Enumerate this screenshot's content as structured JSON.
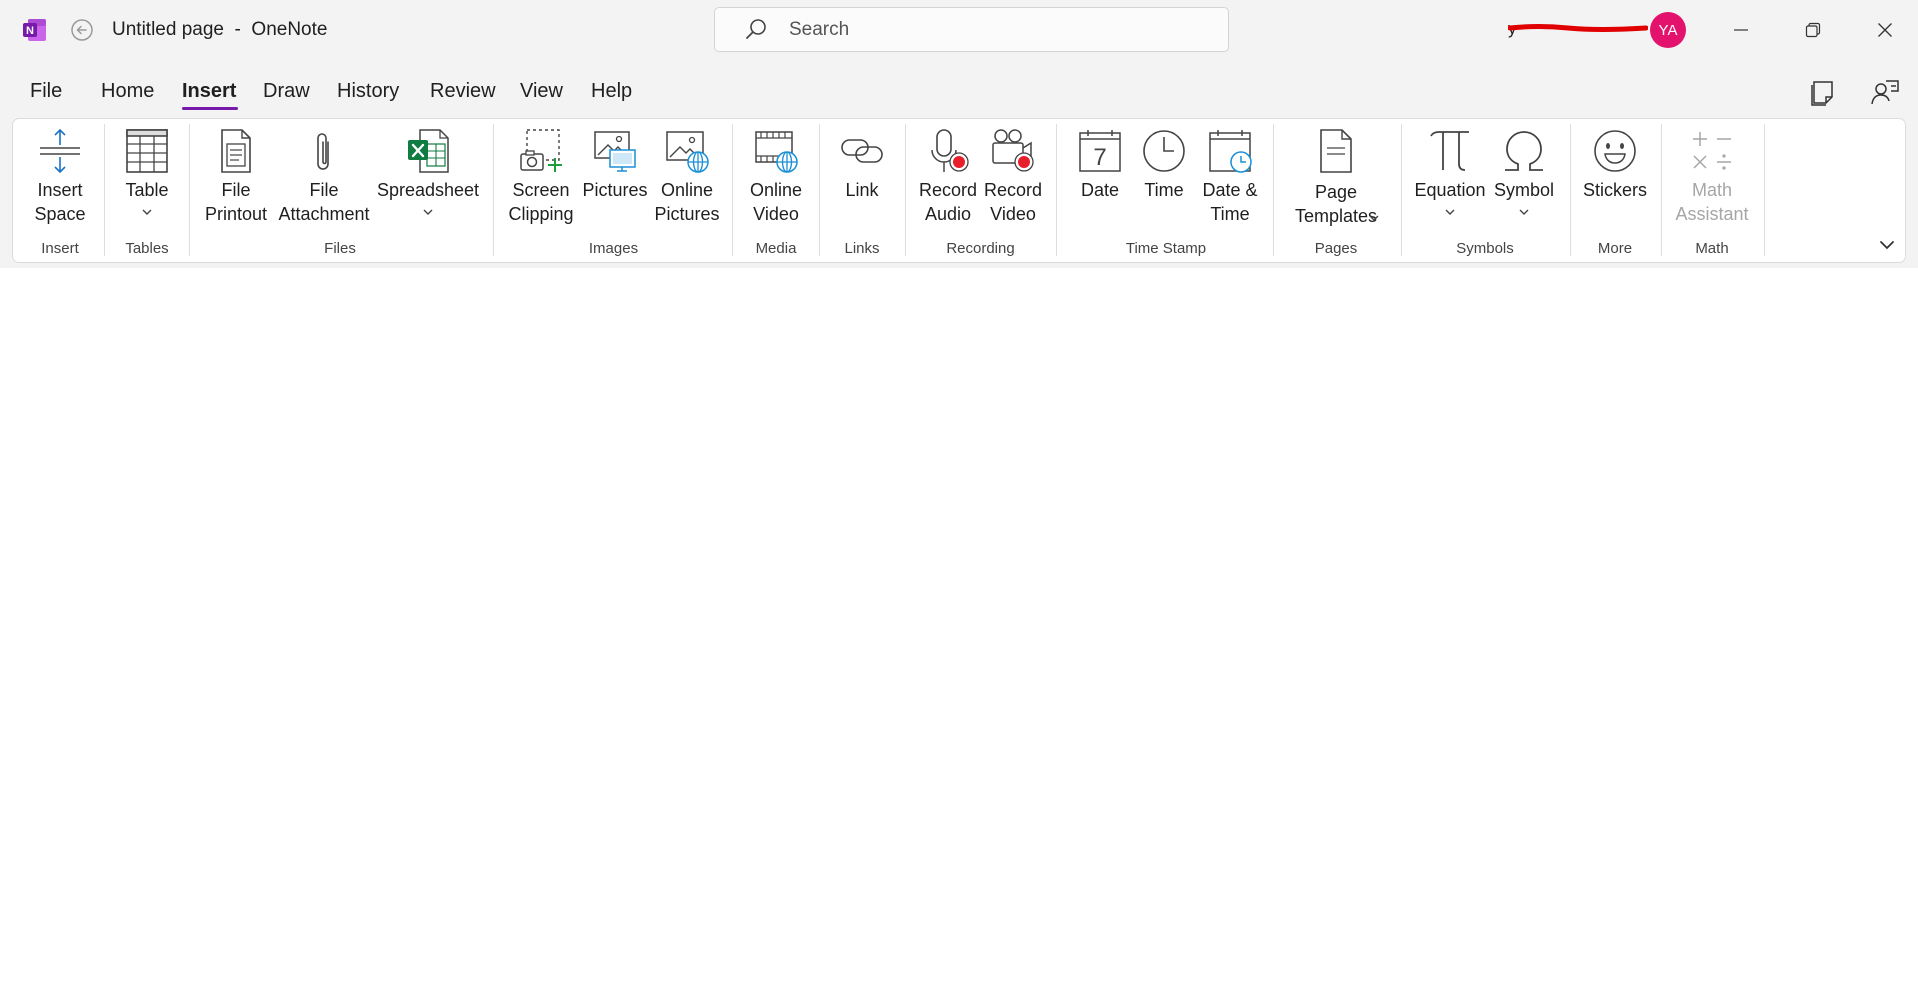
{
  "window": {
    "title": "Untitled page  -  OneNote",
    "account_name": "y",
    "avatar_initials": "YA",
    "avatar_color": "#e3126c",
    "accent_color": "#7719aa"
  },
  "search": {
    "placeholder": "Search"
  },
  "tabs": [
    "File",
    "Home",
    "Insert",
    "Draw",
    "History",
    "Review",
    "View",
    "Help"
  ],
  "active_tab": "Insert",
  "ribbon": {
    "insert_space": "Insert\nSpace",
    "table": "Table",
    "file_printout": "File\nPrintout",
    "file_attachment": "File\nAttachment",
    "spreadsheet": "Spreadsheet",
    "screen_clipping": "Screen\nClipping",
    "pictures": "Pictures",
    "online_pictures": "Online\nPictures",
    "online_video": "Online\nVideo",
    "link": "Link",
    "record_audio": "Record\nAudio",
    "record_video": "Record\nVideo",
    "date": "Date",
    "time": "Time",
    "date_time": "Date &\nTime",
    "page_templates": "Page\nTemplates",
    "equation": "Equation",
    "symbol": "Symbol",
    "stickers": "Stickers",
    "math_assistant": "Math\nAssistant"
  },
  "groups": {
    "insert": "Insert",
    "tables": "Tables",
    "files": "Files",
    "images": "Images",
    "media": "Media",
    "links": "Links",
    "recording": "Recording",
    "time_stamp": "Time Stamp",
    "pages": "Pages",
    "symbols": "Symbols",
    "more": "More",
    "math": "Math"
  },
  "icons": {
    "app": "onenote-logo-icon",
    "back": "back-arrow-icon",
    "search": "search-icon",
    "minimize": "minimize-icon",
    "restore": "restore-icon",
    "close": "close-icon",
    "sticky_notes": "sticky-notes-icon",
    "share": "share-icon"
  }
}
